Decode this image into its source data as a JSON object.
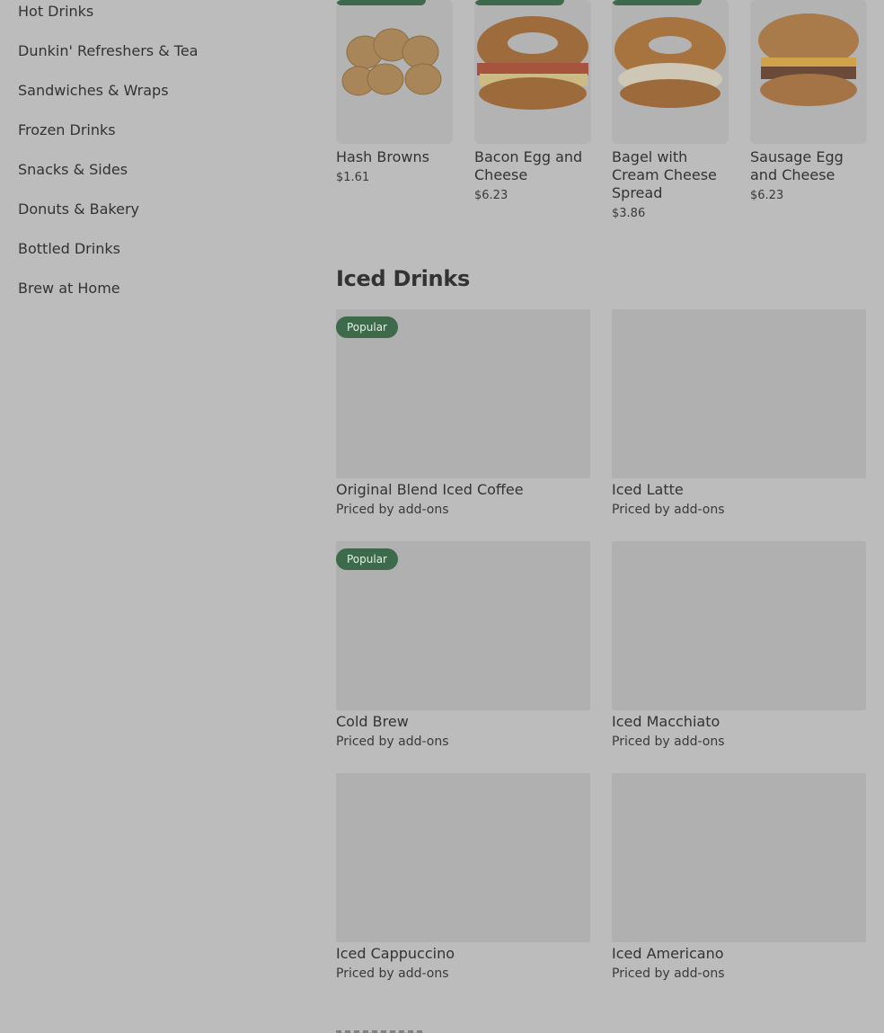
{
  "sidebar": {
    "items": [
      {
        "label": "Hot Drinks"
      },
      {
        "label": "Dunkin' Refreshers & Tea"
      },
      {
        "label": "Sandwiches & Wraps"
      },
      {
        "label": "Frozen Drinks"
      },
      {
        "label": "Snacks & Sides"
      },
      {
        "label": "Donuts & Bakery"
      },
      {
        "label": "Bottled Drinks"
      },
      {
        "label": "Brew at Home"
      }
    ]
  },
  "top_products": [
    {
      "name": "Hash Browns",
      "price": "$1.61"
    },
    {
      "name": "Bacon Egg and Cheese",
      "price": "$6.23"
    },
    {
      "name": "Bagel with Cream Cheese Spread",
      "price": "$3.86"
    },
    {
      "name": "Sausage Egg and Cheese",
      "price": "$6.23"
    }
  ],
  "iced_drinks": {
    "title": "Iced Drinks",
    "items": [
      {
        "name": "Original Blend Iced Coffee",
        "price": "Priced by add-ons",
        "badge": "Popular"
      },
      {
        "name": "Iced Latte",
        "price": "Priced by add-ons",
        "badge": ""
      },
      {
        "name": "Cold Brew",
        "price": "Priced by add-ons",
        "badge": "Popular"
      },
      {
        "name": "Iced Macchiato",
        "price": "Priced by add-ons",
        "badge": ""
      },
      {
        "name": "Iced Cappuccino",
        "price": "Priced by add-ons",
        "badge": ""
      },
      {
        "name": "Iced Americano",
        "price": "Priced by add-ons",
        "badge": ""
      }
    ]
  },
  "colors": {
    "overlay_background": "#bcbcbc",
    "badge_green": "#3c6a4a",
    "placeholder_gray": "#b0b0b0"
  }
}
